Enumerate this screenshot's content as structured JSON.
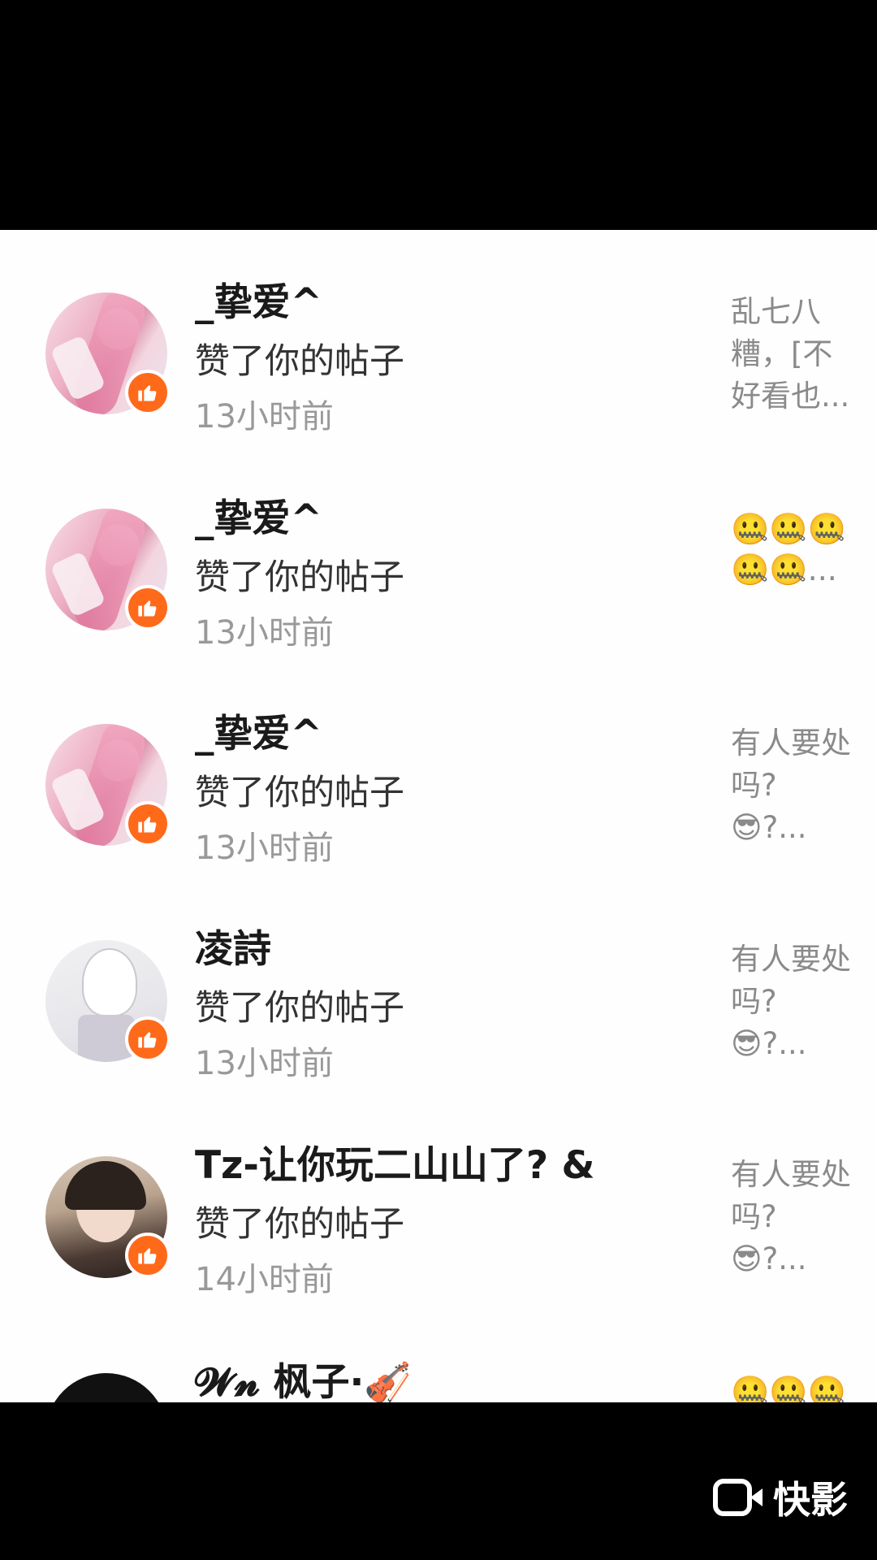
{
  "notifications": [
    {
      "name": "_挚爱^",
      "action": "赞了你的帖子",
      "time": "13小时前",
      "preview": "乱七八糟，[不好看也..."
    },
    {
      "name": "_挚爱^",
      "action": "赞了你的帖子",
      "time": "13小时前",
      "preview": "🤐🤐🤐🤐🤐..."
    },
    {
      "name": "_挚爱^",
      "action": "赞了你的帖子",
      "time": "13小时前",
      "preview": "有人要处吗?😎?..."
    },
    {
      "name": "凌詩",
      "action": "赞了你的帖子",
      "time": "13小时前",
      "preview": "有人要处吗?😎?..."
    },
    {
      "name": "Tz-让你玩二山山了? &",
      "action": "赞了你的帖子",
      "time": "14小时前",
      "preview": "有人要处吗?😎?..."
    },
    {
      "name": "𝓦𝓷 枫子·🎻",
      "action": "",
      "time": "",
      "preview": "🤐🤐🤐"
    }
  ],
  "watermark": {
    "text": "快影"
  },
  "icons": {
    "like_badge": "thumbs-up-icon"
  },
  "colors": {
    "accent": "#ff6a1a"
  }
}
